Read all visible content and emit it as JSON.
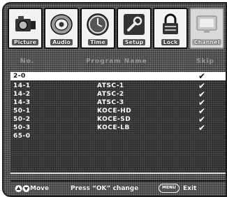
{
  "tabs": [
    {
      "label": "Picture",
      "icon": "camera-icon",
      "active": false
    },
    {
      "label": "Audio",
      "icon": "speaker-icon",
      "active": false
    },
    {
      "label": "Time",
      "icon": "clock-icon",
      "active": false
    },
    {
      "label": "Setup",
      "icon": "wrench-icon",
      "active": false
    },
    {
      "label": "Lock",
      "icon": "lock-icon",
      "active": false
    },
    {
      "label": "Channel",
      "icon": "tv-icon",
      "active": true
    }
  ],
  "header": {
    "col_no": "No.",
    "col_name": "Program Name",
    "col_fav": "Skip"
  },
  "channels": [
    {
      "number": "2-0",
      "name": "",
      "checked": true,
      "selected": true
    },
    {
      "number": "14-1",
      "name": "ATSC-1",
      "checked": true,
      "selected": false
    },
    {
      "number": "14-2",
      "name": "ATSC-2",
      "checked": true,
      "selected": false
    },
    {
      "number": "14-3",
      "name": "ATSC-3",
      "checked": true,
      "selected": false
    },
    {
      "number": "50-1",
      "name": "KOCE-HD",
      "checked": true,
      "selected": false
    },
    {
      "number": "50-2",
      "name": "KOCE-SD",
      "checked": true,
      "selected": false
    },
    {
      "number": "50-3",
      "name": "KOCE-LB",
      "checked": true,
      "selected": false
    },
    {
      "number": "65-0",
      "name": "",
      "checked": false,
      "selected": false
    }
  ],
  "footer": {
    "move_label": "Move",
    "ok_label": "Press “OK” change",
    "menu_key": "MENU",
    "exit_label": "Exit"
  },
  "check_glyph": "✔"
}
